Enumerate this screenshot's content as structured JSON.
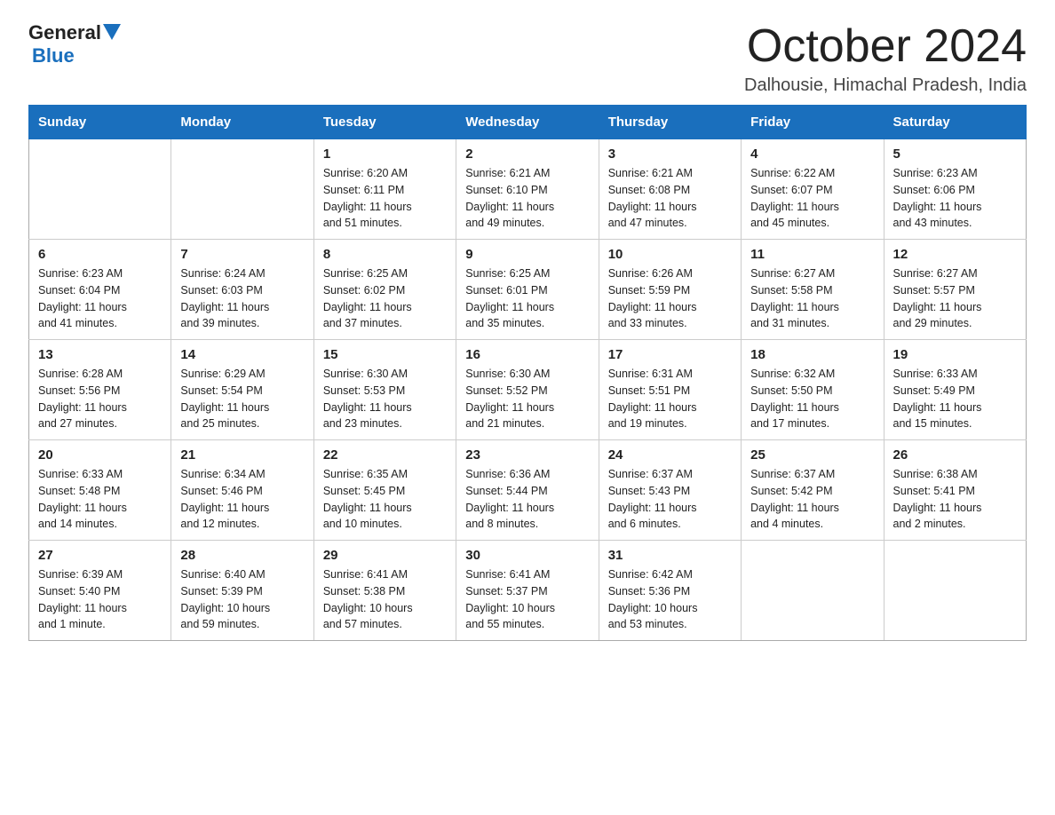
{
  "logo": {
    "general": "General",
    "triangle": "▶",
    "blue": "Blue"
  },
  "title": "October 2024",
  "subtitle": "Dalhousie, Himachal Pradesh, India",
  "days_of_week": [
    "Sunday",
    "Monday",
    "Tuesday",
    "Wednesday",
    "Thursday",
    "Friday",
    "Saturday"
  ],
  "weeks": [
    [
      {
        "day": "",
        "info": ""
      },
      {
        "day": "",
        "info": ""
      },
      {
        "day": "1",
        "info": "Sunrise: 6:20 AM\nSunset: 6:11 PM\nDaylight: 11 hours\nand 51 minutes."
      },
      {
        "day": "2",
        "info": "Sunrise: 6:21 AM\nSunset: 6:10 PM\nDaylight: 11 hours\nand 49 minutes."
      },
      {
        "day": "3",
        "info": "Sunrise: 6:21 AM\nSunset: 6:08 PM\nDaylight: 11 hours\nand 47 minutes."
      },
      {
        "day": "4",
        "info": "Sunrise: 6:22 AM\nSunset: 6:07 PM\nDaylight: 11 hours\nand 45 minutes."
      },
      {
        "day": "5",
        "info": "Sunrise: 6:23 AM\nSunset: 6:06 PM\nDaylight: 11 hours\nand 43 minutes."
      }
    ],
    [
      {
        "day": "6",
        "info": "Sunrise: 6:23 AM\nSunset: 6:04 PM\nDaylight: 11 hours\nand 41 minutes."
      },
      {
        "day": "7",
        "info": "Sunrise: 6:24 AM\nSunset: 6:03 PM\nDaylight: 11 hours\nand 39 minutes."
      },
      {
        "day": "8",
        "info": "Sunrise: 6:25 AM\nSunset: 6:02 PM\nDaylight: 11 hours\nand 37 minutes."
      },
      {
        "day": "9",
        "info": "Sunrise: 6:25 AM\nSunset: 6:01 PM\nDaylight: 11 hours\nand 35 minutes."
      },
      {
        "day": "10",
        "info": "Sunrise: 6:26 AM\nSunset: 5:59 PM\nDaylight: 11 hours\nand 33 minutes."
      },
      {
        "day": "11",
        "info": "Sunrise: 6:27 AM\nSunset: 5:58 PM\nDaylight: 11 hours\nand 31 minutes."
      },
      {
        "day": "12",
        "info": "Sunrise: 6:27 AM\nSunset: 5:57 PM\nDaylight: 11 hours\nand 29 minutes."
      }
    ],
    [
      {
        "day": "13",
        "info": "Sunrise: 6:28 AM\nSunset: 5:56 PM\nDaylight: 11 hours\nand 27 minutes."
      },
      {
        "day": "14",
        "info": "Sunrise: 6:29 AM\nSunset: 5:54 PM\nDaylight: 11 hours\nand 25 minutes."
      },
      {
        "day": "15",
        "info": "Sunrise: 6:30 AM\nSunset: 5:53 PM\nDaylight: 11 hours\nand 23 minutes."
      },
      {
        "day": "16",
        "info": "Sunrise: 6:30 AM\nSunset: 5:52 PM\nDaylight: 11 hours\nand 21 minutes."
      },
      {
        "day": "17",
        "info": "Sunrise: 6:31 AM\nSunset: 5:51 PM\nDaylight: 11 hours\nand 19 minutes."
      },
      {
        "day": "18",
        "info": "Sunrise: 6:32 AM\nSunset: 5:50 PM\nDaylight: 11 hours\nand 17 minutes."
      },
      {
        "day": "19",
        "info": "Sunrise: 6:33 AM\nSunset: 5:49 PM\nDaylight: 11 hours\nand 15 minutes."
      }
    ],
    [
      {
        "day": "20",
        "info": "Sunrise: 6:33 AM\nSunset: 5:48 PM\nDaylight: 11 hours\nand 14 minutes."
      },
      {
        "day": "21",
        "info": "Sunrise: 6:34 AM\nSunset: 5:46 PM\nDaylight: 11 hours\nand 12 minutes."
      },
      {
        "day": "22",
        "info": "Sunrise: 6:35 AM\nSunset: 5:45 PM\nDaylight: 11 hours\nand 10 minutes."
      },
      {
        "day": "23",
        "info": "Sunrise: 6:36 AM\nSunset: 5:44 PM\nDaylight: 11 hours\nand 8 minutes."
      },
      {
        "day": "24",
        "info": "Sunrise: 6:37 AM\nSunset: 5:43 PM\nDaylight: 11 hours\nand 6 minutes."
      },
      {
        "day": "25",
        "info": "Sunrise: 6:37 AM\nSunset: 5:42 PM\nDaylight: 11 hours\nand 4 minutes."
      },
      {
        "day": "26",
        "info": "Sunrise: 6:38 AM\nSunset: 5:41 PM\nDaylight: 11 hours\nand 2 minutes."
      }
    ],
    [
      {
        "day": "27",
        "info": "Sunrise: 6:39 AM\nSunset: 5:40 PM\nDaylight: 11 hours\nand 1 minute."
      },
      {
        "day": "28",
        "info": "Sunrise: 6:40 AM\nSunset: 5:39 PM\nDaylight: 10 hours\nand 59 minutes."
      },
      {
        "day": "29",
        "info": "Sunrise: 6:41 AM\nSunset: 5:38 PM\nDaylight: 10 hours\nand 57 minutes."
      },
      {
        "day": "30",
        "info": "Sunrise: 6:41 AM\nSunset: 5:37 PM\nDaylight: 10 hours\nand 55 minutes."
      },
      {
        "day": "31",
        "info": "Sunrise: 6:42 AM\nSunset: 5:36 PM\nDaylight: 10 hours\nand 53 minutes."
      },
      {
        "day": "",
        "info": ""
      },
      {
        "day": "",
        "info": ""
      }
    ]
  ]
}
